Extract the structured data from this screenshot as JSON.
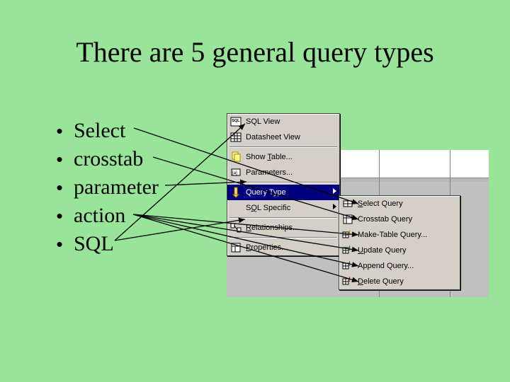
{
  "title": "There are 5 general query types",
  "bullets": [
    "Select",
    "crosstab",
    "parameter",
    "action",
    "SQL"
  ],
  "menu1": {
    "items": [
      {
        "label": "SQL View",
        "icon": "sql-icon",
        "under": ""
      },
      {
        "label": "Datasheet View",
        "icon": "datasheet-icon",
        "under": ""
      },
      "---",
      {
        "label": "Show Table...",
        "icon": "show-table-icon",
        "under": "T"
      },
      {
        "label": "Parameters...",
        "icon": "params-icon",
        "under": "M"
      },
      "---",
      {
        "label": "Query Type",
        "icon": "query-type-icon",
        "under": "",
        "submenu": true,
        "highlight": true
      },
      {
        "label": "SQL Specific",
        "icon": "",
        "under": "Q",
        "submenu": true
      },
      "---",
      {
        "label": "Relationships...",
        "icon": "relations-icon",
        "under": "R"
      },
      "---",
      {
        "label": "Properties...",
        "icon": "properties-icon",
        "under": "P"
      }
    ]
  },
  "menu2": {
    "items": [
      {
        "label": "Select Query",
        "icon": "select-query-icon",
        "under": "S"
      },
      {
        "label": "Crosstab Query",
        "icon": "crosstab-query-icon",
        "under": ""
      },
      {
        "label": "Make-Table Query...",
        "icon": "maketable-icon",
        "under": "K"
      },
      {
        "label": "Update Query",
        "icon": "update-query-icon",
        "under": "U"
      },
      {
        "label": "Append Query...",
        "icon": "append-query-icon",
        "under": ""
      },
      {
        "label": "Delete Query",
        "icon": "delete-query-icon",
        "under": "D"
      }
    ]
  }
}
